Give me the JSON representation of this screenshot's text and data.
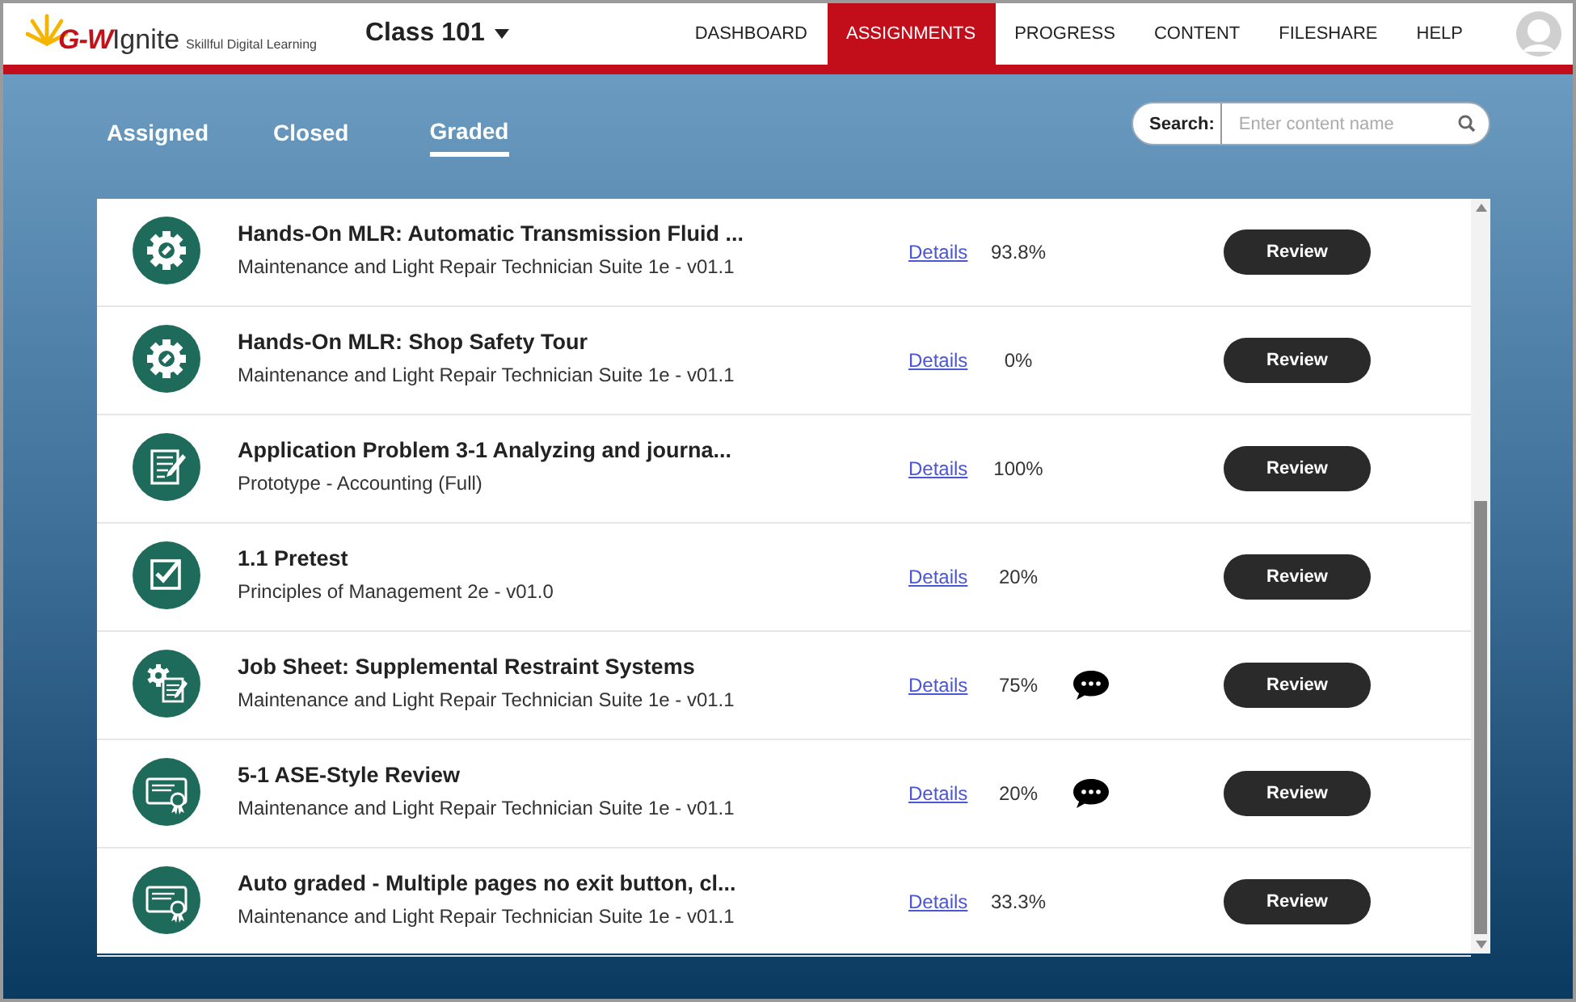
{
  "header": {
    "logo_brand": "G-W",
    "logo_name": "Ignite",
    "logo_tagline": "Skillful Digital Learning",
    "class_name": "Class 101",
    "nav": [
      {
        "label": "DASHBOARD",
        "selected": false
      },
      {
        "label": "ASSIGNMENTS",
        "selected": true
      },
      {
        "label": "PROGRESS",
        "selected": false
      },
      {
        "label": "CONTENT",
        "selected": false
      },
      {
        "label": "FILESHARE",
        "selected": false
      },
      {
        "label": "HELP",
        "selected": false
      }
    ]
  },
  "tabs": [
    {
      "label": "Assigned",
      "selected": false
    },
    {
      "label": "Closed",
      "selected": false
    },
    {
      "label": "Graded",
      "selected": true
    }
  ],
  "search": {
    "label": "Search:",
    "placeholder": "Enter content name"
  },
  "rows": [
    {
      "kind": "gear",
      "title": "Hands-On MLR: Automatic Transmission Fluid ...",
      "subtitle": "Maintenance and Light Repair Technician Suite 1e - v01.1",
      "link": "Details",
      "score": "93.8%",
      "has_comment": false,
      "button": "Review"
    },
    {
      "kind": "gear",
      "title": "Hands-On MLR: Shop Safety Tour",
      "subtitle": "Maintenance and Light Repair Technician Suite 1e - v01.1",
      "link": "Details",
      "score": "0%",
      "has_comment": false,
      "button": "Review"
    },
    {
      "kind": "document",
      "title": "Application Problem 3-1 Analyzing and journa...",
      "subtitle": "Prototype - Accounting (Full)",
      "link": "Details",
      "score": "100%",
      "has_comment": false,
      "button": "Review"
    },
    {
      "kind": "checkbox",
      "title": "1.1 Pretest",
      "subtitle": "Principles of Management 2e - v01.0",
      "link": "Details",
      "score": "20%",
      "has_comment": false,
      "button": "Review"
    },
    {
      "kind": "jobsheet",
      "title": "Job Sheet: Supplemental Restraint Systems",
      "subtitle": "Maintenance and Light Repair Technician Suite 1e - v01.1",
      "link": "Details",
      "score": "75%",
      "has_comment": true,
      "button": "Review"
    },
    {
      "kind": "certificate",
      "title": "5-1 ASE-Style Review",
      "subtitle": "Maintenance and Light Repair Technician Suite 1e - v01.1",
      "link": "Details",
      "score": "20%",
      "has_comment": true,
      "button": "Review"
    },
    {
      "kind": "certificate",
      "title": "Auto graded - Multiple pages no exit button, cl...",
      "subtitle": "Maintenance and Light Repair Technician Suite 1e - v01.1",
      "link": "Details",
      "score": "33.3%",
      "has_comment": false,
      "button": "Review"
    }
  ]
}
